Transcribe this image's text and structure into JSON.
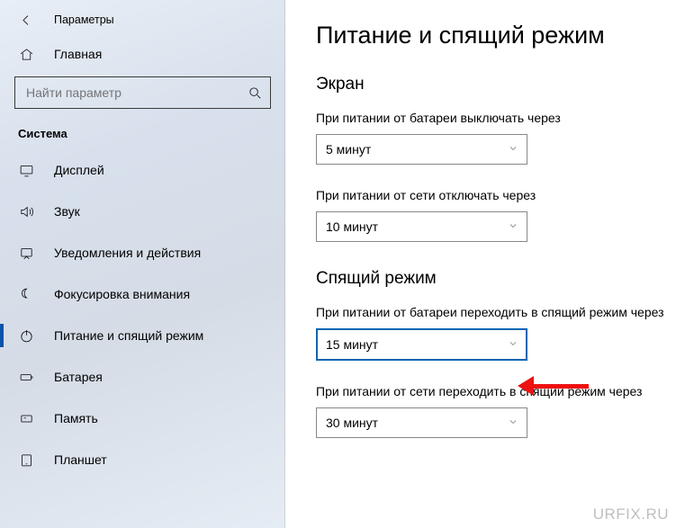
{
  "window": {
    "title": "Параметры"
  },
  "home": {
    "label": "Главная"
  },
  "search": {
    "placeholder": "Найти параметр"
  },
  "category": {
    "label": "Система"
  },
  "nav": {
    "display": {
      "label": "Дисплей"
    },
    "sound": {
      "label": "Звук"
    },
    "notify": {
      "label": "Уведомления и действия"
    },
    "focus": {
      "label": "Фокусировка внимания"
    },
    "power": {
      "label": "Питание и спящий режим"
    },
    "battery": {
      "label": "Батарея"
    },
    "storage": {
      "label": "Память"
    },
    "tablet": {
      "label": "Планшет"
    }
  },
  "page": {
    "heading": "Питание и спящий режим",
    "screen": {
      "title": "Экран",
      "battery_off": {
        "label": "При питании от батареи выключать через",
        "value": "5 минут"
      },
      "ac_off": {
        "label": "При питании от сети отключать через",
        "value": "10 минут"
      }
    },
    "sleep": {
      "title": "Спящий режим",
      "battery_sleep": {
        "label": "При питании от батареи переходить в спящий режим через",
        "value": "15 минут"
      },
      "ac_sleep": {
        "label": "При питании от сети переходить в спящий режим через",
        "value": "30 минут"
      }
    }
  },
  "watermark": "URFIX.RU"
}
